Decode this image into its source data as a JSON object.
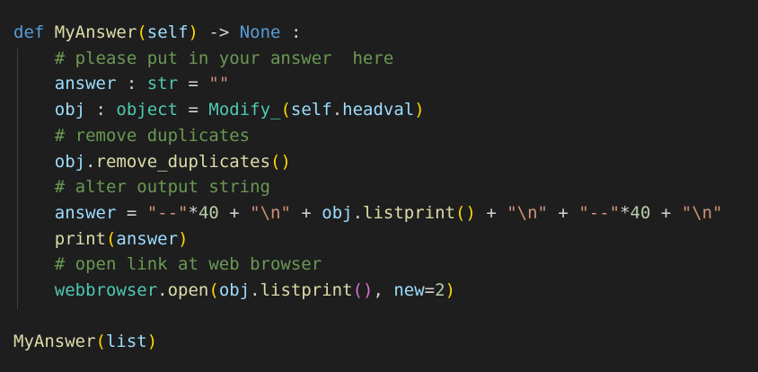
{
  "lines": [
    [
      {
        "t": "def",
        "c": "kw"
      },
      {
        "t": " ",
        "c": "op"
      },
      {
        "t": "MyAnswer",
        "c": "fn"
      },
      {
        "t": "(",
        "c": "b1"
      },
      {
        "t": "self",
        "c": "var"
      },
      {
        "t": ")",
        "c": "b1"
      },
      {
        "t": " -> ",
        "c": "op"
      },
      {
        "t": "None",
        "c": "kw"
      },
      {
        "t": " :",
        "c": "op"
      }
    ],
    [
      {
        "t": "    ",
        "c": "op"
      },
      {
        "t": "# please put in your answer  here",
        "c": "cmt"
      }
    ],
    [
      {
        "t": "    ",
        "c": "op"
      },
      {
        "t": "answer",
        "c": "var"
      },
      {
        "t": " : ",
        "c": "op"
      },
      {
        "t": "str",
        "c": "type"
      },
      {
        "t": " = ",
        "c": "op"
      },
      {
        "t": "\"\"",
        "c": "str"
      }
    ],
    [
      {
        "t": "    ",
        "c": "op"
      },
      {
        "t": "obj",
        "c": "var"
      },
      {
        "t": " : ",
        "c": "op"
      },
      {
        "t": "object",
        "c": "type"
      },
      {
        "t": " = ",
        "c": "op"
      },
      {
        "t": "Modify_",
        "c": "type"
      },
      {
        "t": "(",
        "c": "b1"
      },
      {
        "t": "self",
        "c": "var"
      },
      {
        "t": ".",
        "c": "op"
      },
      {
        "t": "headval",
        "c": "var"
      },
      {
        "t": ")",
        "c": "b1"
      }
    ],
    [
      {
        "t": "    ",
        "c": "op"
      },
      {
        "t": "# remove duplicates",
        "c": "cmt"
      }
    ],
    [
      {
        "t": "    ",
        "c": "op"
      },
      {
        "t": "obj",
        "c": "var"
      },
      {
        "t": ".",
        "c": "op"
      },
      {
        "t": "remove_duplicates",
        "c": "fn"
      },
      {
        "t": "()",
        "c": "b1"
      }
    ],
    [
      {
        "t": "    ",
        "c": "op"
      },
      {
        "t": "# alter output string",
        "c": "cmt"
      }
    ],
    [
      {
        "t": "    ",
        "c": "op"
      },
      {
        "t": "answer",
        "c": "var"
      },
      {
        "t": " = ",
        "c": "op"
      },
      {
        "t": "\"--\"",
        "c": "str"
      },
      {
        "t": "*",
        "c": "op"
      },
      {
        "t": "40",
        "c": "num"
      },
      {
        "t": " + ",
        "c": "op"
      },
      {
        "t": "\"\\n\"",
        "c": "str"
      },
      {
        "t": " + ",
        "c": "op"
      },
      {
        "t": "obj",
        "c": "var"
      },
      {
        "t": ".",
        "c": "op"
      },
      {
        "t": "listprint",
        "c": "fn"
      },
      {
        "t": "()",
        "c": "b1"
      },
      {
        "t": " + ",
        "c": "op"
      },
      {
        "t": "\"\\n\"",
        "c": "str"
      },
      {
        "t": " + ",
        "c": "op"
      },
      {
        "t": "\"--\"",
        "c": "str"
      },
      {
        "t": "*",
        "c": "op"
      },
      {
        "t": "40",
        "c": "num"
      },
      {
        "t": " + ",
        "c": "op"
      },
      {
        "t": "\"\\n\"",
        "c": "str"
      }
    ],
    [
      {
        "t": "    ",
        "c": "op"
      },
      {
        "t": "print",
        "c": "fn"
      },
      {
        "t": "(",
        "c": "b1"
      },
      {
        "t": "answer",
        "c": "var"
      },
      {
        "t": ")",
        "c": "b1"
      }
    ],
    [
      {
        "t": "    ",
        "c": "op"
      },
      {
        "t": "# open link at web browser",
        "c": "cmt"
      }
    ],
    [
      {
        "t": "    ",
        "c": "op"
      },
      {
        "t": "webbrowser",
        "c": "type"
      },
      {
        "t": ".",
        "c": "op"
      },
      {
        "t": "open",
        "c": "fn"
      },
      {
        "t": "(",
        "c": "b1"
      },
      {
        "t": "obj",
        "c": "var"
      },
      {
        "t": ".",
        "c": "op"
      },
      {
        "t": "listprint",
        "c": "fn"
      },
      {
        "t": "()",
        "c": "b2"
      },
      {
        "t": ", ",
        "c": "op"
      },
      {
        "t": "new",
        "c": "var"
      },
      {
        "t": "=",
        "c": "op"
      },
      {
        "t": "2",
        "c": "num"
      },
      {
        "t": ")",
        "c": "b1"
      }
    ],
    [],
    [
      {
        "t": "MyAnswer",
        "c": "fn"
      },
      {
        "t": "(",
        "c": "b1"
      },
      {
        "t": "list",
        "c": "var"
      },
      {
        "t": ")",
        "c": "b1"
      }
    ]
  ]
}
